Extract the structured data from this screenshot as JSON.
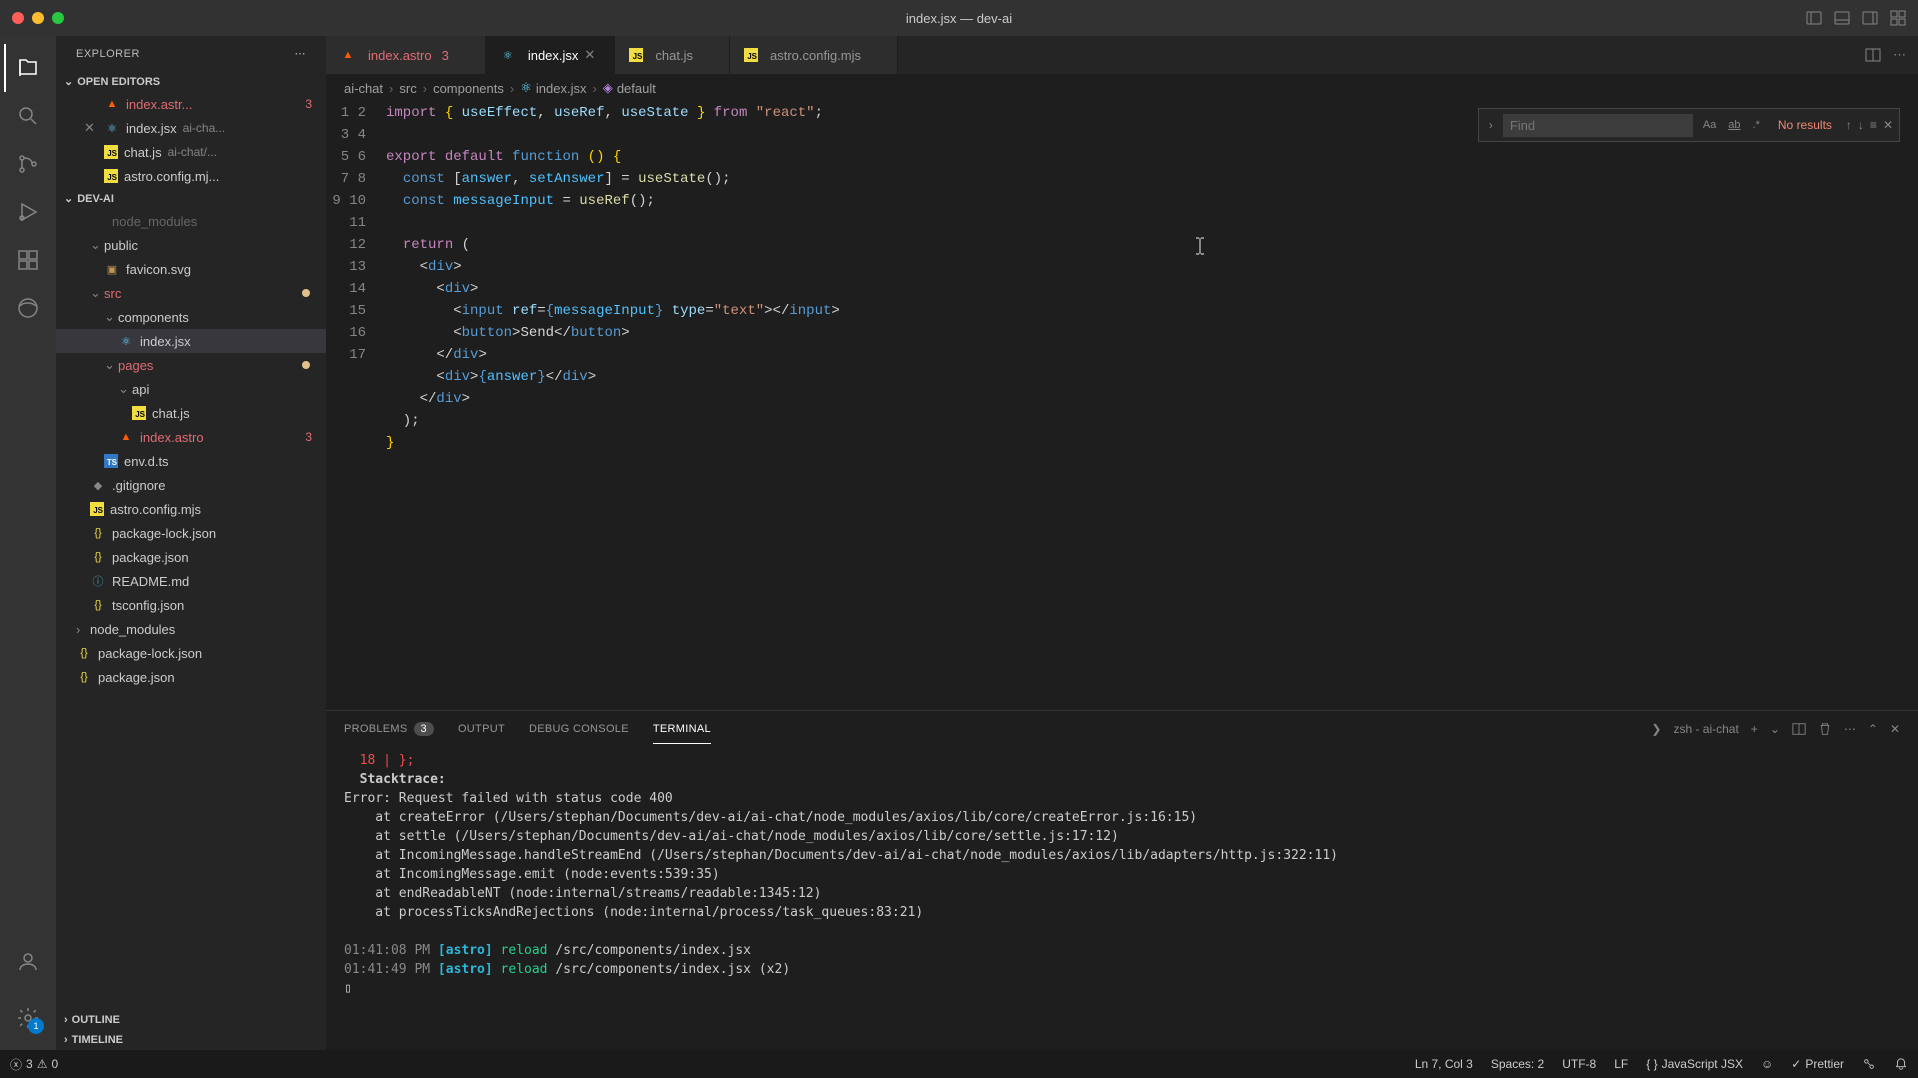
{
  "titlebar": {
    "title": "index.jsx — dev-ai"
  },
  "sidebar": {
    "title": "EXPLORER",
    "sections": {
      "open_editors": "OPEN EDITORS",
      "project": "DEV-AI",
      "outline": "OUTLINE",
      "timeline": "TIMELINE"
    },
    "open_editors_items": [
      {
        "name": "index.astr...",
        "badge": "3",
        "icon": "astro"
      },
      {
        "name": "index.jsx",
        "suffix": "ai-cha...",
        "icon": "react",
        "active": true
      },
      {
        "name": "chat.js",
        "suffix": "ai-chat/...",
        "icon": "js"
      },
      {
        "name": "astro.config.mj...",
        "icon": "js"
      }
    ],
    "tree": [
      {
        "name": "node_modules",
        "indent": 1,
        "partial": true
      },
      {
        "name": "public",
        "indent": 1,
        "folder": true,
        "open": true
      },
      {
        "name": "favicon.svg",
        "indent": 2,
        "icon": "svg"
      },
      {
        "name": "src",
        "indent": 1,
        "folder": true,
        "open": true,
        "err": true,
        "dot": true
      },
      {
        "name": "components",
        "indent": 2,
        "folder": true,
        "open": true
      },
      {
        "name": "index.jsx",
        "indent": 3,
        "icon": "react",
        "active": true
      },
      {
        "name": "pages",
        "indent": 2,
        "folder": true,
        "open": true,
        "err": true,
        "dot": true
      },
      {
        "name": "api",
        "indent": 3,
        "folder": true,
        "open": true
      },
      {
        "name": "chat.js",
        "indent": 4,
        "icon": "js"
      },
      {
        "name": "index.astro",
        "indent": 3,
        "icon": "astro",
        "err": true,
        "badge": "3"
      },
      {
        "name": "env.d.ts",
        "indent": 2,
        "icon": "ts"
      },
      {
        "name": ".gitignore",
        "indent": 1,
        "icon": "git"
      },
      {
        "name": "astro.config.mjs",
        "indent": 1,
        "icon": "js"
      },
      {
        "name": "package-lock.json",
        "indent": 1,
        "icon": "brace"
      },
      {
        "name": "package.json",
        "indent": 1,
        "icon": "brace"
      },
      {
        "name": "README.md",
        "indent": 1,
        "icon": "md"
      },
      {
        "name": "tsconfig.json",
        "indent": 1,
        "icon": "brace"
      },
      {
        "name": "node_modules",
        "indent": 0,
        "folder": true
      },
      {
        "name": "package-lock.json",
        "indent": 0,
        "icon": "brace"
      },
      {
        "name": "package.json",
        "indent": 0,
        "icon": "brace"
      }
    ]
  },
  "tabs": [
    {
      "name": "index.astro",
      "badge": "3",
      "icon": "astro",
      "err": true
    },
    {
      "name": "index.jsx",
      "icon": "react",
      "active": true
    },
    {
      "name": "chat.js",
      "icon": "js"
    },
    {
      "name": "astro.config.mjs",
      "icon": "js"
    }
  ],
  "breadcrumb": [
    "ai-chat",
    "src",
    "components",
    "index.jsx",
    "default"
  ],
  "find": {
    "placeholder": "Find",
    "results": "No results"
  },
  "code_lines": 17,
  "panel": {
    "tabs": {
      "problems": "PROBLEMS",
      "problems_count": "3",
      "output": "OUTPUT",
      "debug": "DEBUG CONSOLE",
      "terminal": "TERMINAL"
    },
    "shell": "zsh - ai-chat"
  },
  "terminal": {
    "l1": "  18 | };",
    "l2": "  Stacktrace:",
    "l3": "Error: Request failed with status code 400",
    "l4": "    at createError (/Users/stephan/Documents/dev-ai/ai-chat/node_modules/axios/lib/core/createError.js:16:15)",
    "l5": "    at settle (/Users/stephan/Documents/dev-ai/ai-chat/node_modules/axios/lib/core/settle.js:17:12)",
    "l6": "    at IncomingMessage.handleStreamEnd (/Users/stephan/Documents/dev-ai/ai-chat/node_modules/axios/lib/adapters/http.js:322:11)",
    "l7": "    at IncomingMessage.emit (node:events:539:35)",
    "l8": "    at endReadableNT (node:internal/streams/readable:1345:12)",
    "l9": "    at processTicksAndRejections (node:internal/process/task_queues:83:21)",
    "l10_time": "01:41:08 PM",
    "l10_tag": "[astro]",
    "l10_action": "reload",
    "l10_path": "/src/components/index.jsx",
    "l11_time": "01:41:49 PM",
    "l11_tag": "[astro]",
    "l11_action": "reload",
    "l11_path": "/src/components/index.jsx (x2)"
  },
  "status": {
    "errors": "3",
    "warnings": "0",
    "ln_col": "Ln 7, Col 3",
    "spaces": "Spaces: 2",
    "encoding": "UTF-8",
    "eol": "LF",
    "lang": "JavaScript JSX",
    "prettier": "Prettier"
  }
}
